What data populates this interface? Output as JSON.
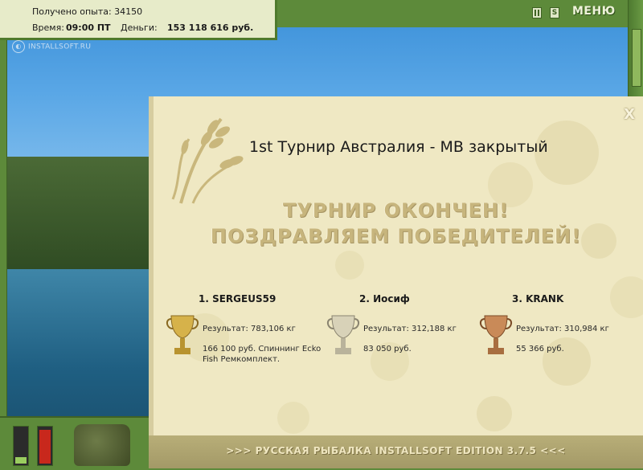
{
  "stats": {
    "experience_label": "Получено опыта: 34150",
    "time_label": "Время:",
    "time_value": "09:00 ПТ",
    "money_label": "Деньги:",
    "money_value": "153 118 616 руб."
  },
  "topbar": {
    "pause_icon": "pause-icon",
    "settings_icon": "s-icon",
    "menu_label": "МЕНЮ"
  },
  "watermark": "INSTALLSOFT.RU",
  "dialog": {
    "title": "1st Турнир Австралия - МВ закрытый",
    "heading_line1": "ТУРНИР ОКОНЧЕН!",
    "heading_line2": "ПОЗДРАВЛЯЕМ ПОБЕДИТЕЛЕЙ!",
    "close_label": "X",
    "winners": [
      {
        "name": "1. SERGEUS59",
        "result": "Результат: 783,106 кг",
        "prize": "166 100 руб. Спиннинг Ecko Fish Ремкомплект.",
        "cup": "gold"
      },
      {
        "name": "2. Иосиф",
        "result": "Результат: 312,188 кг",
        "prize": "83 050 руб.",
        "cup": "silver"
      },
      {
        "name": "3. KRANK",
        "result": "Результат: 310,984 кг",
        "prize": "55 366 руб.",
        "cup": "bronze"
      }
    ],
    "footer": ">>> РУССКАЯ РЫБАЛКА INSTALLSOFT EDITION 3.7.5 <<<"
  },
  "colors": {
    "frame_green": "#5d8a3a",
    "dialog_bg": "#efe8c3",
    "gold": "#d6b24a",
    "silver": "#c9c4b4",
    "bronze": "#c98a58"
  }
}
